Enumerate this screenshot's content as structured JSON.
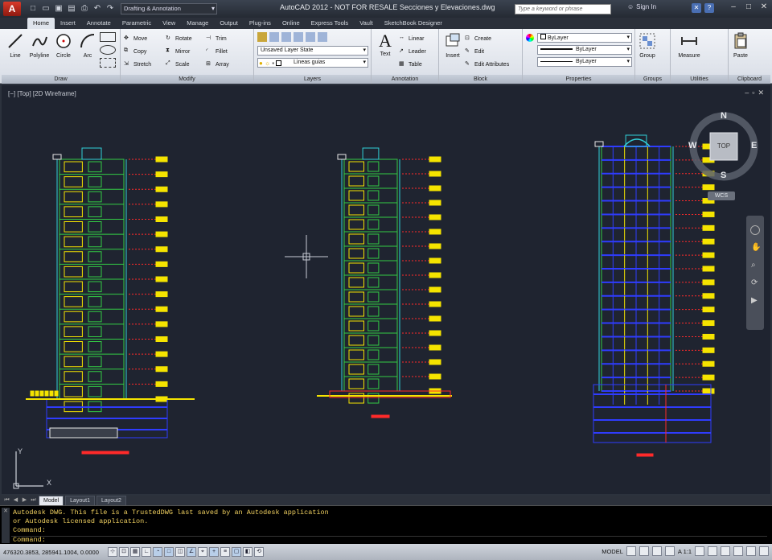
{
  "titlebar": {
    "title": "AutoCAD 2012 - NOT FOR RESALE    Secciones y Elevaciones.dwg",
    "workspace": "Drafting & Annotation",
    "search_placeholder": "Type a keyword or phrase",
    "signin": "Sign In",
    "logo_letter": "A"
  },
  "ribbon_tabs": [
    "Home",
    "Insert",
    "Annotate",
    "Parametric",
    "View",
    "Manage",
    "Output",
    "Plug-ins",
    "Online",
    "Express Tools",
    "Vault",
    "SketchBook Designer"
  ],
  "ribbon": {
    "draw": {
      "label": "Draw",
      "tools": [
        "Line",
        "Polyline",
        "Circle",
        "Arc"
      ]
    },
    "modify": {
      "label": "Modify",
      "tools": [
        "Move",
        "Rotate",
        "Trim",
        "Copy",
        "Mirror",
        "Fillet",
        "Stretch",
        "Scale",
        "Array"
      ]
    },
    "layers": {
      "label": "Layers",
      "layer_state": "Unsaved Layer State",
      "current_layer": "Lineas guias"
    },
    "annotation": {
      "label": "Annotation",
      "text": "Text",
      "tools": [
        "Linear",
        "Leader",
        "Table"
      ]
    },
    "block": {
      "label": "Block",
      "insert": "Insert",
      "tools": [
        "Create",
        "Edit",
        "Edit Attributes"
      ]
    },
    "properties": {
      "label": "Properties",
      "values": [
        "ByLayer",
        "ByLayer",
        "ByLayer"
      ]
    },
    "groups": {
      "label": "Groups",
      "group": "Group"
    },
    "utilities": {
      "label": "Utilities",
      "measure": "Measure"
    },
    "clipboard": {
      "label": "Clipboard",
      "paste": "Paste"
    }
  },
  "viewport": {
    "label": "[−] [Top] [2D Wireframe]",
    "viewcube": {
      "n": "N",
      "s": "S",
      "e": "E",
      "w": "W",
      "top": "TOP",
      "wcs": "WCS"
    },
    "ucs": {
      "x": "X",
      "y": "Y"
    }
  },
  "layout_tabs": [
    "Model",
    "Layout1",
    "Layout2"
  ],
  "command_line": {
    "lines": [
      "Autodesk DWG.  This file is a TrustedDWG last saved by an Autodesk application",
      "or Autodesk licensed application.",
      "Command:",
      "Command:"
    ]
  },
  "statusbar": {
    "coords": "476320.3853, 285941.1004, 0.0000",
    "model": "MODEL",
    "scale": "A 1:1"
  },
  "colors": {
    "background": "#1f2430",
    "yellow": "#f5e400",
    "blue": "#2f3cff",
    "green": "#33cc44",
    "red": "#ff2a2a",
    "cyan": "#30d0d8",
    "white": "#e8e8e8"
  }
}
